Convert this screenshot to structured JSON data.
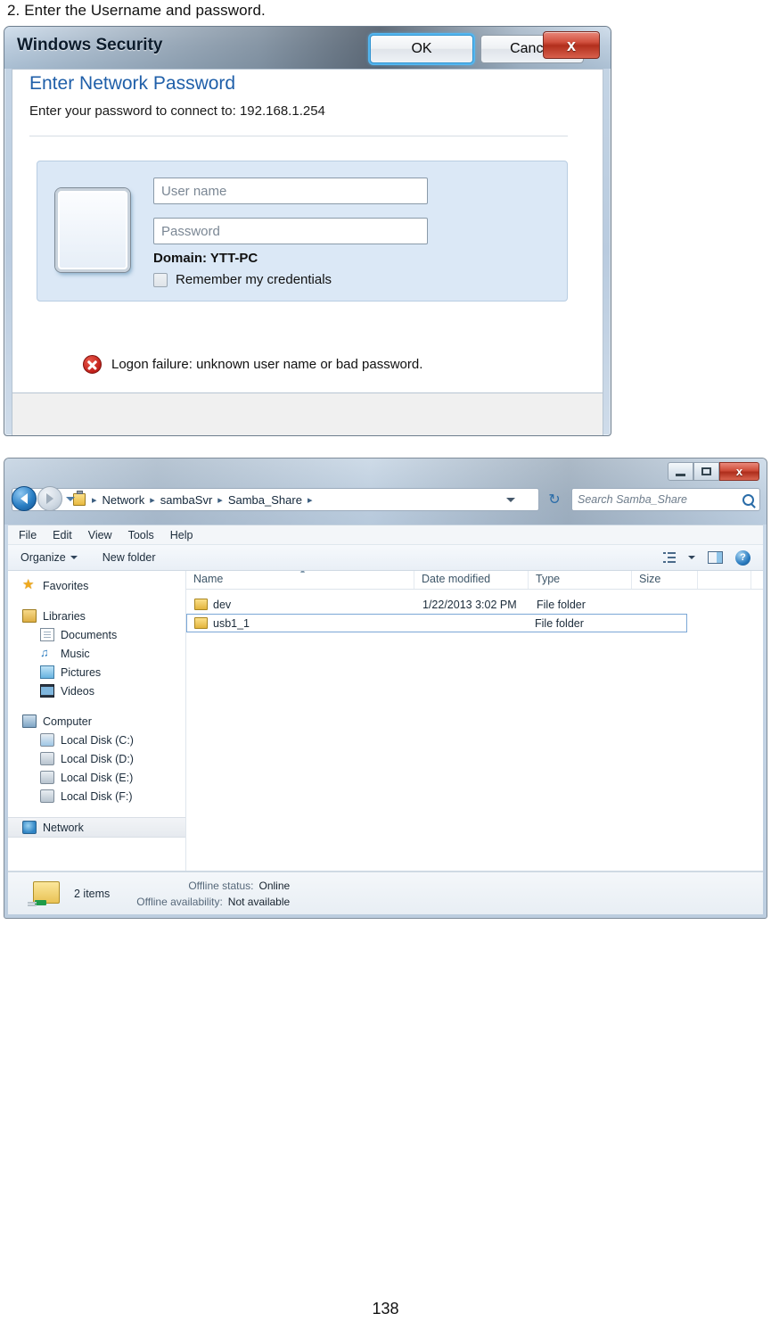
{
  "instruction": "2. Enter the Username and password.",
  "security_dialog": {
    "title": "Windows Security",
    "close_label": "x",
    "heading": "Enter Network Password",
    "subheading": "Enter your password to connect to: 192.168.1.254",
    "username_placeholder": "User name",
    "password_placeholder": "Password",
    "domain": "Domain: YTT-PC",
    "remember_label": "Remember my credentials",
    "error_text": "Logon failure: unknown user name or bad password.",
    "ok_label": "OK",
    "cancel_label": "Cancel",
    "accent_color": "#1f5fa9",
    "panel_color": "#dbe8f6",
    "error_color": "#c1201a",
    "focus_color": "#54b6ef"
  },
  "explorer": {
    "window_controls": {
      "minimize": "minimize-button",
      "maximize": "maximize-button",
      "close": "x"
    },
    "address": {
      "crumbs": [
        "Network",
        "sambaSvr",
        "Samba_Share"
      ],
      "separator": "▸"
    },
    "search": {
      "placeholder": "Search Samba_Share"
    },
    "menubar": [
      "File",
      "Edit",
      "View",
      "Tools",
      "Help"
    ],
    "toolbar": {
      "organize": "Organize",
      "new_folder": "New folder",
      "help_glyph": "?"
    },
    "navpane": [
      {
        "label": "Favorites",
        "icon": "star-icon",
        "level": 0,
        "selected": false,
        "gap": false
      },
      {
        "label": "Libraries",
        "icon": "libraries-icon",
        "level": 0,
        "selected": false,
        "gap": true
      },
      {
        "label": "Documents",
        "icon": "documents-icon",
        "level": 1,
        "selected": false,
        "gap": false
      },
      {
        "label": "Music",
        "icon": "music-icon",
        "level": 1,
        "selected": false,
        "gap": false
      },
      {
        "label": "Pictures",
        "icon": "pictures-icon",
        "level": 1,
        "selected": false,
        "gap": false
      },
      {
        "label": "Videos",
        "icon": "videos-icon",
        "level": 1,
        "selected": false,
        "gap": false
      },
      {
        "label": "Computer",
        "icon": "computer-icon",
        "level": 0,
        "selected": false,
        "gap": true
      },
      {
        "label": "Local Disk (C:)",
        "icon": "system-disk-icon",
        "level": 1,
        "selected": false,
        "gap": false
      },
      {
        "label": "Local Disk (D:)",
        "icon": "disk-icon",
        "level": 1,
        "selected": false,
        "gap": false
      },
      {
        "label": "Local Disk (E:)",
        "icon": "disk-icon",
        "level": 1,
        "selected": false,
        "gap": false
      },
      {
        "label": "Local Disk (F:)",
        "icon": "disk-icon",
        "level": 1,
        "selected": false,
        "gap": false
      },
      {
        "label": "Network",
        "icon": "network-icon",
        "level": 0,
        "selected": true,
        "gap": true
      }
    ],
    "columns": [
      "Name",
      "Date modified",
      "Type",
      "Size"
    ],
    "rows": [
      {
        "name": "dev",
        "date_modified": "1/22/2013 3:02 PM",
        "type": "File folder",
        "size": "",
        "selected": false
      },
      {
        "name": "usb1_1",
        "date_modified": "",
        "type": "File folder",
        "size": "",
        "selected": true
      }
    ],
    "statusbar": {
      "items": "2 items",
      "offline_status_label": "Offline status:",
      "offline_status_value": "Online",
      "offline_availability_label": "Offline availability:",
      "offline_availability_value": "Not available"
    }
  },
  "page_number": "138"
}
